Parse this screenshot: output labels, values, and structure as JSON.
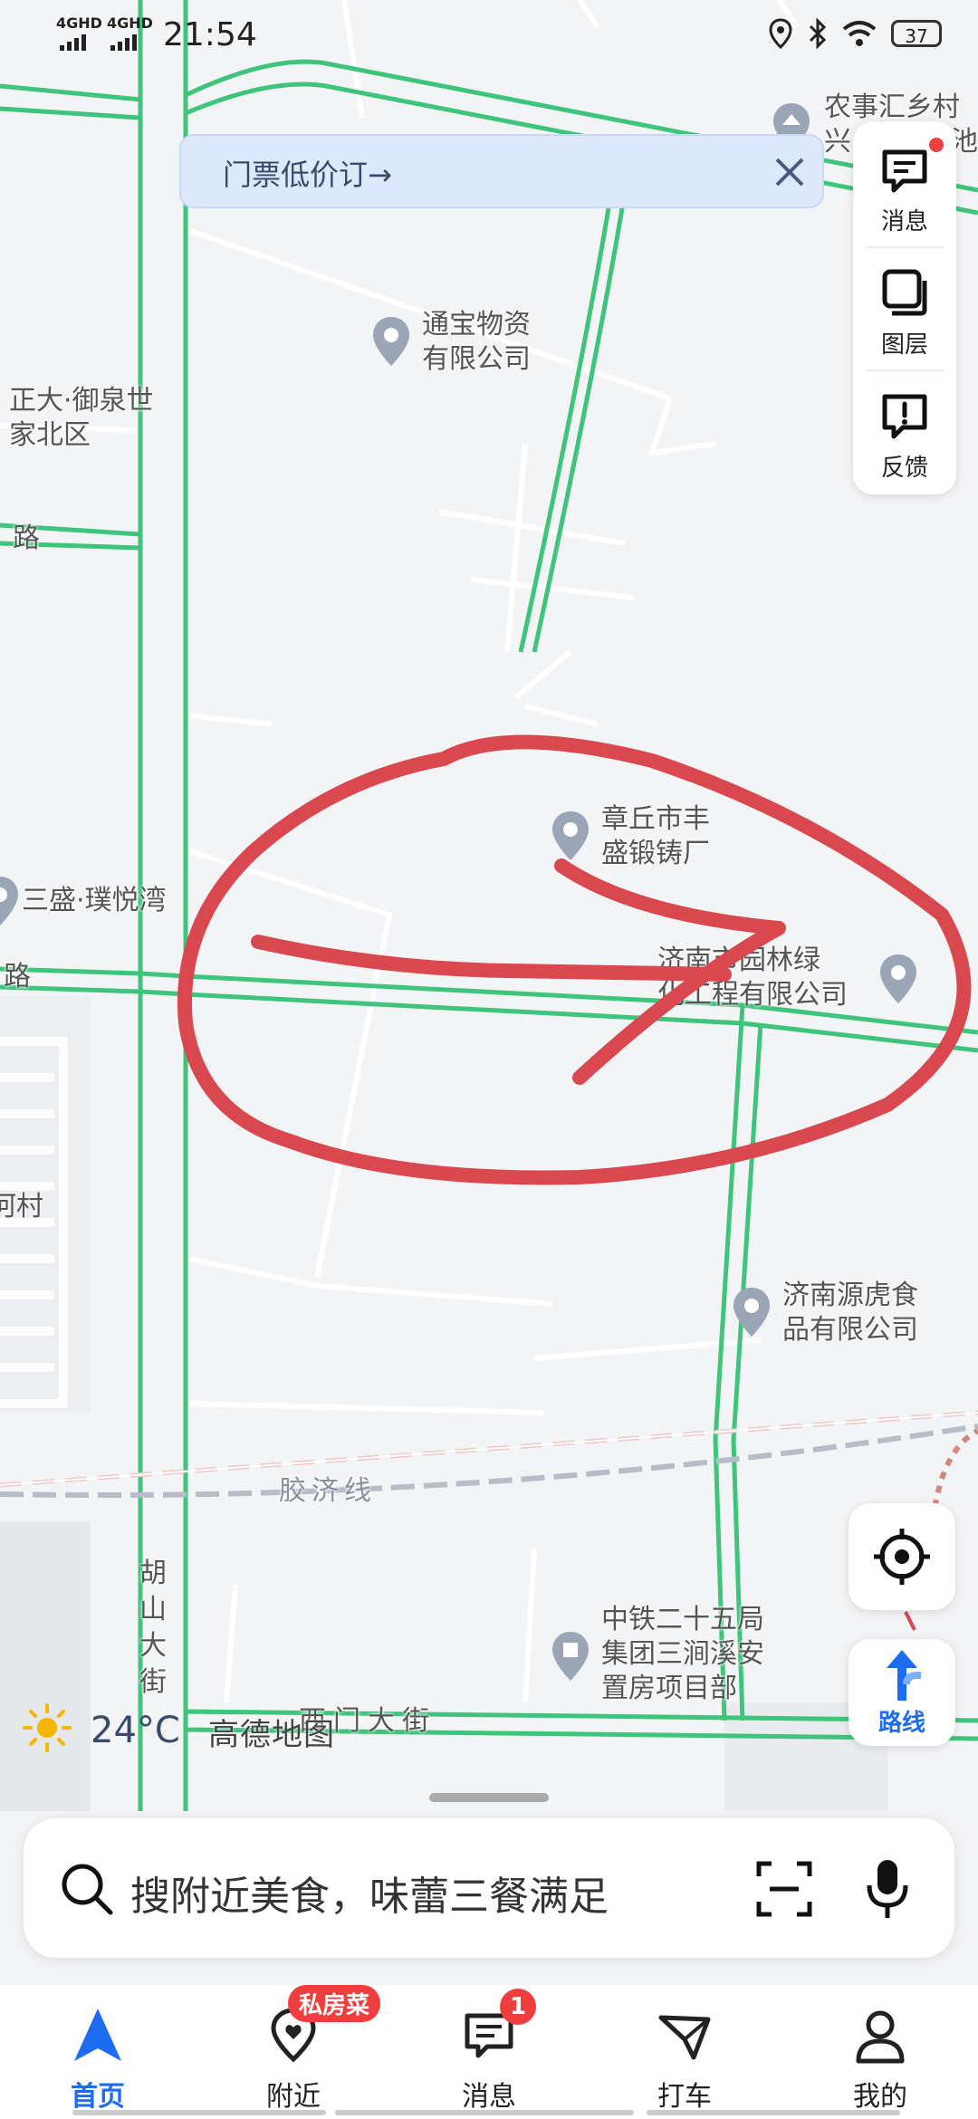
{
  "status_bar": {
    "network_1": "4GHD",
    "network_2": "4GHD",
    "time": "21:54",
    "battery": "37"
  },
  "banner": {
    "text": "门票低价订→"
  },
  "side_panel": {
    "items": [
      {
        "label": "消息",
        "icon": "message-icon",
        "has_dot": true
      },
      {
        "label": "图层",
        "icon": "layers-icon",
        "has_dot": false
      },
      {
        "label": "反馈",
        "icon": "feedback-icon",
        "has_dot": false
      }
    ]
  },
  "map": {
    "labels": {
      "top_right_poi": "农事汇乡村\n兴",
      "top_right_tail": "池",
      "tongbao": "通宝物资\n有限公司",
      "zhengda": "正大·御泉世\n家北区",
      "road_left_1": "路",
      "sansheng": "三盛·璞悦湾",
      "road_left_2": "路",
      "village_left": "河村",
      "zhangqiu": "章丘市丰\n盛锻铸厂",
      "jinan_garden": "济南市园林绿\n化工程有限公司",
      "yuanhu": "济南源虎食\n品有限公司",
      "jiaoji": "胶济线",
      "hushan": "胡\n山\n大\n街",
      "zhongtie": "中铁二十五局\n集团三涧溪安\n置房项目部",
      "ximen": "西门大街"
    },
    "annotation_color": "#d9474f",
    "road_color": "#3fc47b"
  },
  "weather": {
    "temperature": "24°C"
  },
  "watermark": "高德地图",
  "controls": {
    "route_label": "路线"
  },
  "search": {
    "placeholder": "搜附近美食，味蕾三餐满足"
  },
  "bottom_nav": {
    "items": [
      {
        "label": "首页",
        "icon": "home-navigation-icon",
        "active": true
      },
      {
        "label": "附近",
        "icon": "nearby-icon",
        "badge": "私房菜"
      },
      {
        "label": "消息",
        "icon": "message-icon",
        "badge": "1"
      },
      {
        "label": "打车",
        "icon": "taxi-icon"
      },
      {
        "label": "我的",
        "icon": "profile-icon"
      }
    ]
  },
  "colors": {
    "accent": "#1c6cf2",
    "badge": "#f03e3e"
  }
}
